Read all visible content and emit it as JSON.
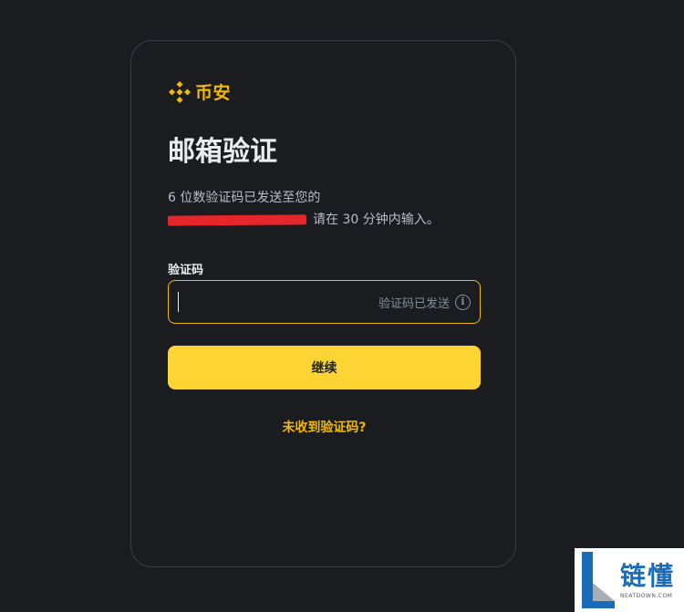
{
  "brand": {
    "name": "币安",
    "color": "#F0B90B",
    "icon": "binance-diamond-icon"
  },
  "page": {
    "title": "邮箱验证"
  },
  "description": {
    "line1": "6 位数验证码已发送至您的",
    "line2_suffix": "请在 30 分钟内输入。"
  },
  "form": {
    "code_label": "验证码",
    "code_value": "",
    "code_status": "验证码已发送",
    "info_icon": "info-icon",
    "continue_label": "继续",
    "resend_label": "未收到验证码?"
  },
  "watermark": {
    "name": "链懂",
    "sub": "NEATDOWN.COM"
  },
  "colors": {
    "background": "#1B1C20",
    "accent": "#F0B90B",
    "button": "#FCD535",
    "redaction": "#E5262A"
  }
}
